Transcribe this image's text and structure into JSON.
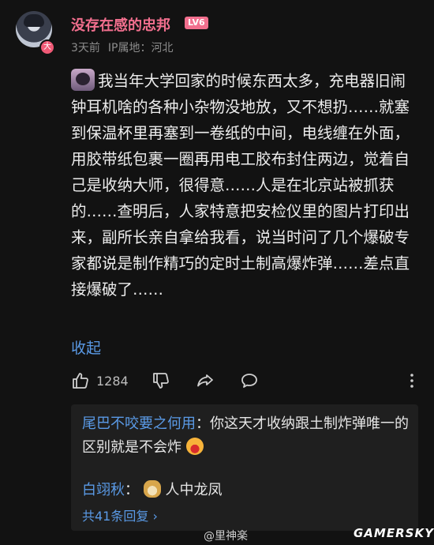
{
  "comment": {
    "username": "没存在感的忠邦",
    "level": "LV6",
    "avatar_badge": "大",
    "time": "3天前",
    "location": "IP属地：河北",
    "text": "我当年大学回家的时候东西太多，充电器旧闹钟耳机啥的各种小杂物没地放，又不想扔……就塞到保温杯里再塞到一卷纸的中间，电线缠在外面，用胶带纸包裹一圈再用电工胶布封住两边，觉着自己是收纳大师，很得意……人是在北京站被抓获的……查明后，人家特意把安检仪里的图片打印出来，副所长亲自拿给我看，说当时问了几个爆破专家都说是制作精巧的定时土制高爆炸弹……差点直接爆破了……",
    "collapse_label": "收起",
    "like_count": "1284",
    "icons": [
      "thumbs-up-icon",
      "thumbs-down-icon",
      "share-icon",
      "comment-icon",
      "more-icon"
    ]
  },
  "replies": [
    {
      "name": "尾巴不咬要之何用",
      "text": "你这天才收纳跟土制炸弹唯一的区别就是不会炸",
      "emoji": "laughing-emoji"
    },
    {
      "name": "白翊秋",
      "text": "人中龙凤",
      "emoji": "doge-emoji"
    }
  ],
  "replies_more": "共41条回复 ›",
  "watermark": "@里神楽",
  "site_logo": "GAMERSKY",
  "colors": {
    "background": "#121212",
    "username": "#f26f8e",
    "link": "#5a9ae6",
    "reply_panel": "#1f1f1f"
  }
}
